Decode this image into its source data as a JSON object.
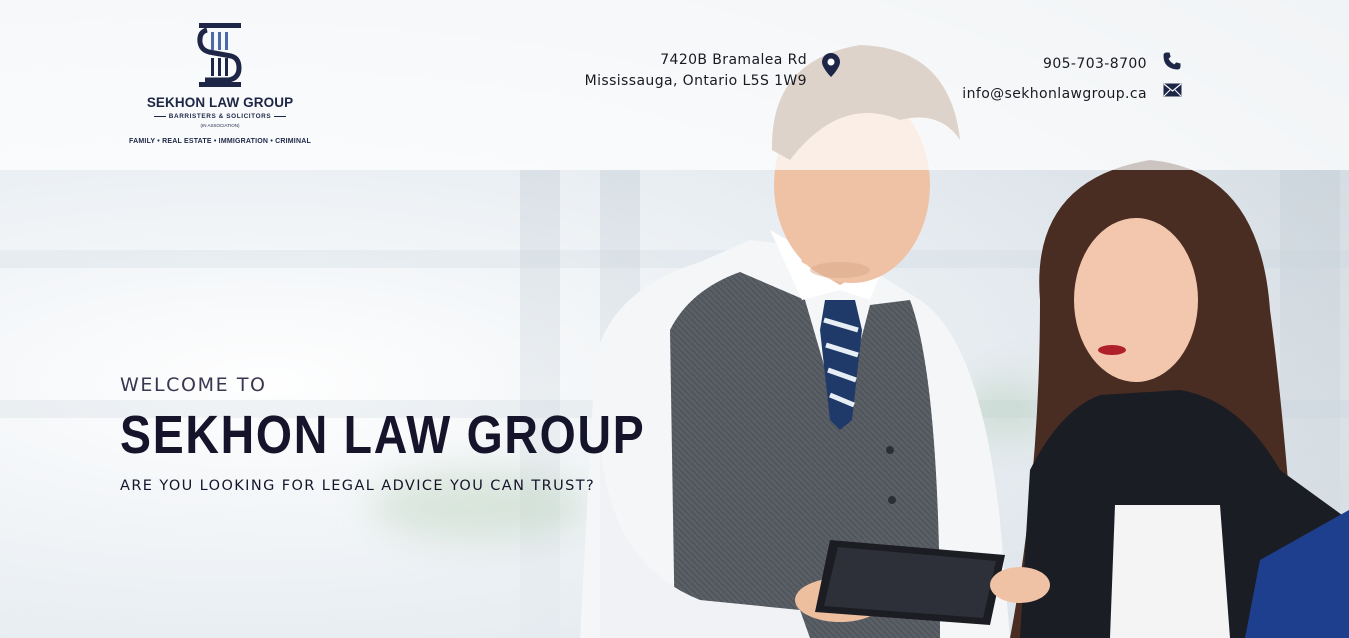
{
  "header": {
    "logo": {
      "name": "SEKHON LAW GROUP",
      "subtitle": "BARRISTERS & SOLICITORS",
      "association": "(IN ASSOCIATION)",
      "practice_areas": "FAMILY • REAL ESTATE • IMMIGRATION • CRIMINAL"
    },
    "address": {
      "line1": "7420B Bramalea Rd",
      "line2": "Mississauga, Ontario L5S 1W9"
    },
    "contact": {
      "phone": "905-703-8700",
      "email": "info@sekhonlawgroup.ca"
    }
  },
  "hero": {
    "welcome": "WELCOME TO",
    "title": "SEKHON LAW GROUP",
    "tagline": "ARE YOU LOOKING FOR LEGAL ADVICE YOU CAN TRUST?"
  },
  "colors": {
    "brand_navy": "#1d2646",
    "heading_dark": "#16142b"
  },
  "icons": [
    "map-pin-icon",
    "phone-icon",
    "mail-icon"
  ]
}
